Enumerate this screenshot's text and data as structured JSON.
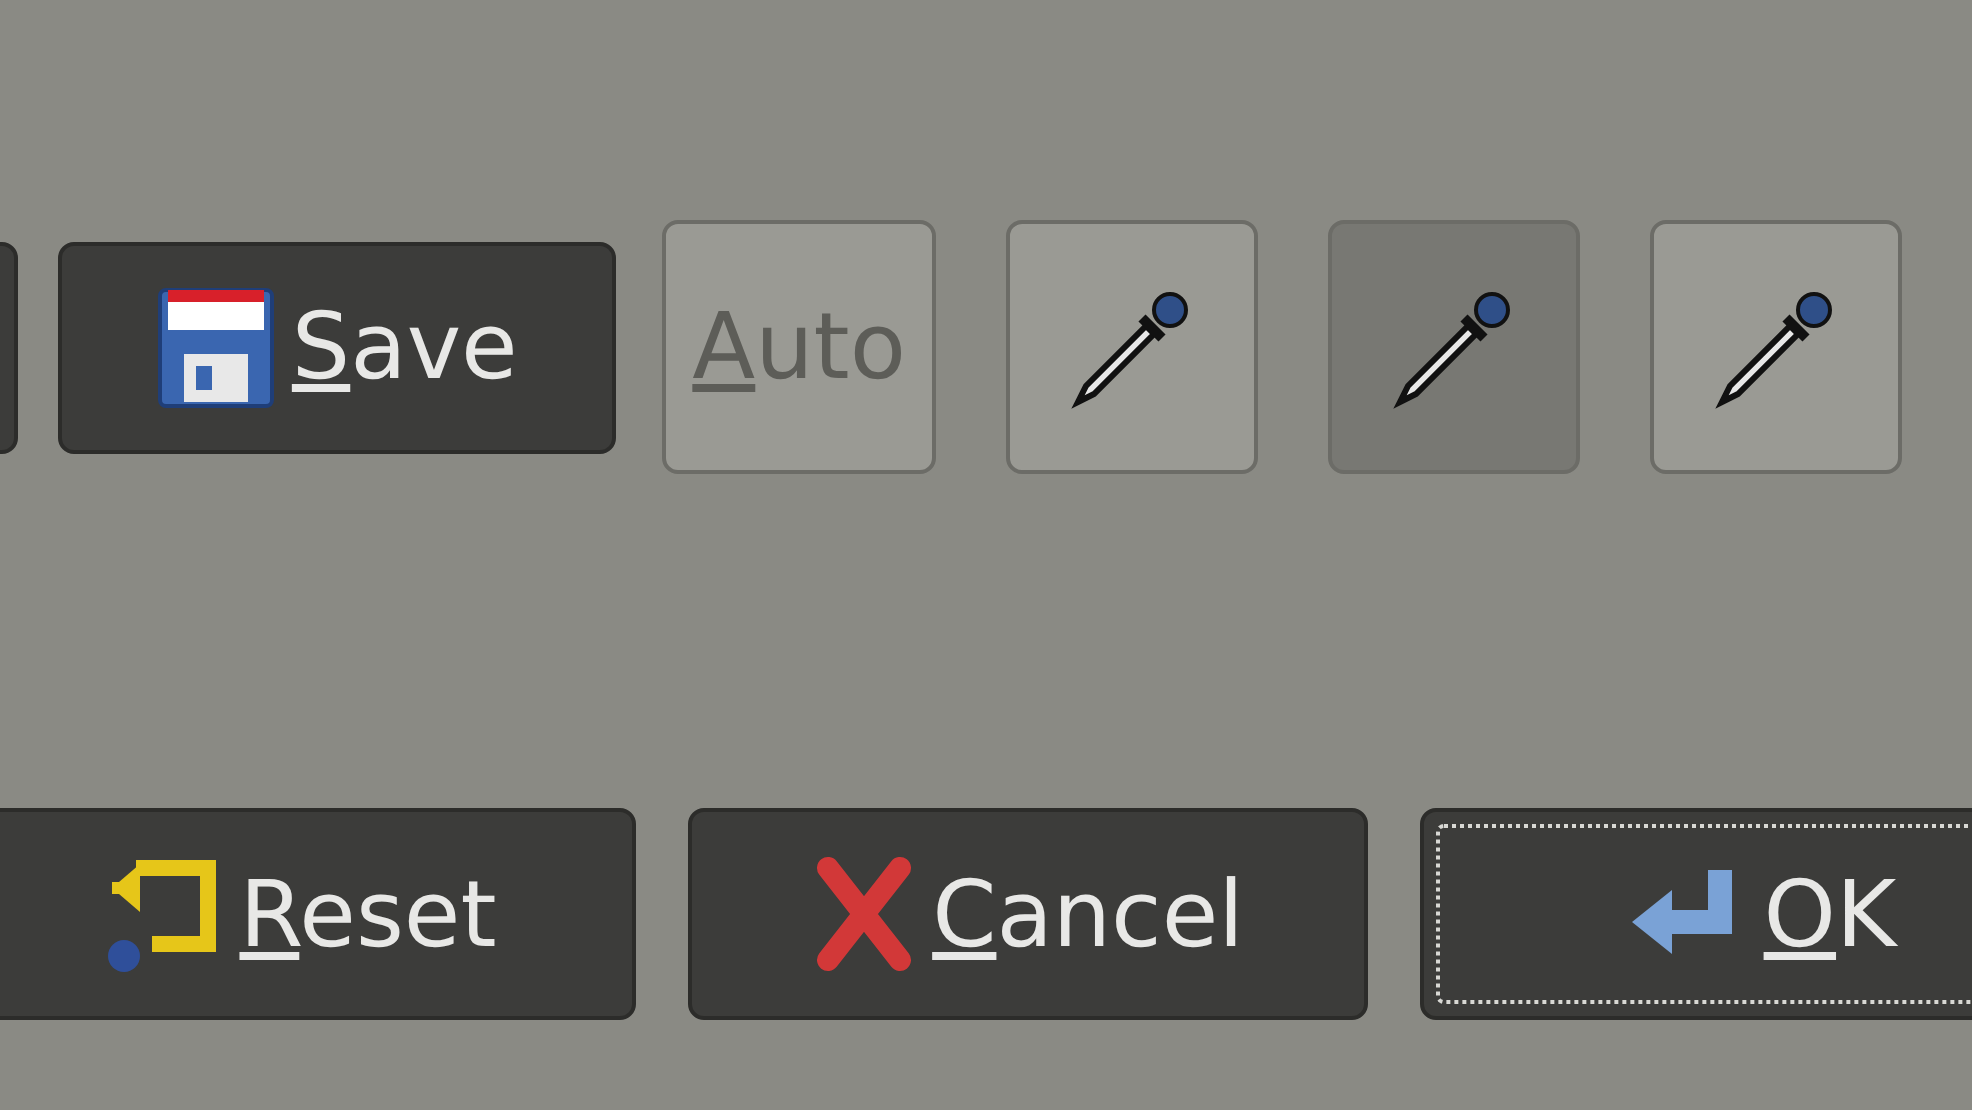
{
  "top_row": [
    {
      "kind": "edge"
    },
    {
      "kind": "save",
      "label": "Save",
      "disabled": false
    },
    {
      "kind": "text",
      "label": "Auto",
      "disabled": true
    },
    {
      "kind": "picker",
      "selected": false
    },
    {
      "kind": "picker",
      "selected": true
    },
    {
      "kind": "picker",
      "selected": false
    }
  ],
  "dialog_buttons": [
    {
      "kind": "reset",
      "label": "Reset",
      "focused": false
    },
    {
      "kind": "cancel",
      "label": "Cancel",
      "focused": false
    },
    {
      "kind": "ok",
      "label": "OK",
      "focused": true
    }
  ]
}
